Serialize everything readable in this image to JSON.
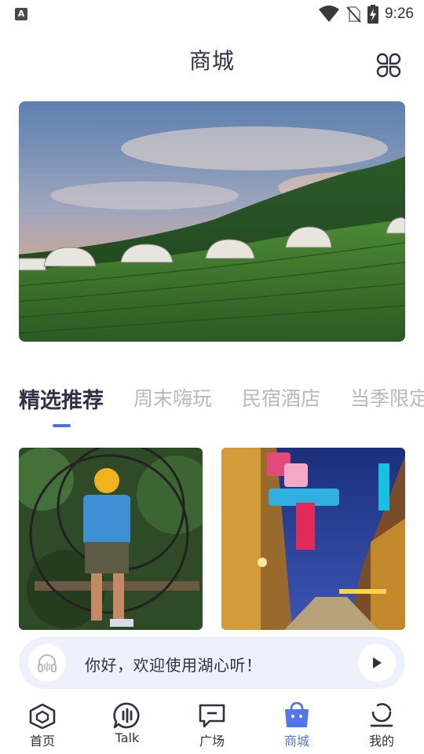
{
  "status_bar": {
    "notification_letter": "A",
    "time": "9:26"
  },
  "header": {
    "title": "商城"
  },
  "tabs": [
    {
      "label": "精选推荐"
    },
    {
      "label": "周末嗨玩"
    },
    {
      "label": "民宿酒店"
    },
    {
      "label": "当季限定"
    }
  ],
  "player": {
    "text": "你好，欢迎使用湖心听！"
  },
  "bottom_nav": [
    {
      "label": "首页",
      "icon": "home-icon"
    },
    {
      "label": "Talk",
      "icon": "talk-icon"
    },
    {
      "label": "广场",
      "icon": "square-icon"
    },
    {
      "label": "商城",
      "icon": "mall-icon"
    },
    {
      "label": "我的",
      "icon": "profile-icon"
    }
  ],
  "colors": {
    "accent": "#5276ec",
    "tab_indicator": "#4b6ee8",
    "inactive_tab": "#b6b9c2",
    "player_bg": "#eef0fb"
  }
}
